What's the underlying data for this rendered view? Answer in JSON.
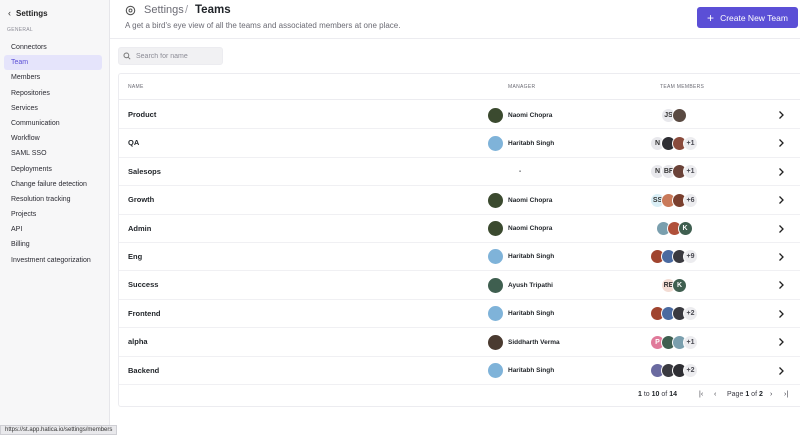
{
  "sidebar": {
    "title": "Settings",
    "section": "GENERAL",
    "items": [
      {
        "label": "Connectors",
        "active": false
      },
      {
        "label": "Team",
        "active": true
      },
      {
        "label": "Members",
        "active": false
      },
      {
        "label": "Repositories",
        "active": false
      },
      {
        "label": "Services",
        "active": false
      },
      {
        "label": "Communication",
        "active": false
      },
      {
        "label": "Workflow",
        "active": false
      },
      {
        "label": "SAML SSO",
        "active": false
      },
      {
        "label": "Deployments",
        "active": false
      },
      {
        "label": "Change failure detection",
        "active": false
      },
      {
        "label": "Resolution tracking",
        "active": false
      },
      {
        "label": "Projects",
        "active": false
      },
      {
        "label": "API",
        "active": false
      },
      {
        "label": "Billing",
        "active": false
      },
      {
        "label": "Investment categorization",
        "active": false
      }
    ]
  },
  "header": {
    "breadcrumb_root": "Settings",
    "breadcrumb_sep": "/",
    "breadcrumb_current": "Teams",
    "subtitle": "A get a bird's eye view of all the teams and associated members at one place.",
    "create_button": "Create New Team"
  },
  "search": {
    "placeholder": "Search for name"
  },
  "table": {
    "columns": {
      "name": "NAME",
      "manager": "MANAGER",
      "members": "TEAM MEMBERS"
    },
    "rows": [
      {
        "name": "Product",
        "manager": "Naomi Chopra",
        "manager_avatar": "#3b4a2f",
        "members": [
          {
            "t": "JS",
            "c": "#e8e8ec"
          },
          {
            "t": "",
            "c": "#5a4a42"
          }
        ],
        "more": ""
      },
      {
        "name": "QA",
        "manager": "Haritabh Singh",
        "manager_avatar": "#7fb3d9",
        "members": [
          {
            "t": "N",
            "c": "#e8e8ec"
          },
          {
            "t": "",
            "c": "#2e2e33"
          },
          {
            "t": "",
            "c": "#8a4b3c"
          }
        ],
        "more": "+1"
      },
      {
        "name": "Salesops",
        "manager": "-",
        "manager_avatar": "",
        "members": [
          {
            "t": "N",
            "c": "#e8e8ec"
          },
          {
            "t": "BF",
            "c": "#e8e8ec"
          },
          {
            "t": "",
            "c": "#6a4238"
          }
        ],
        "more": "+1"
      },
      {
        "name": "Growth",
        "manager": "Naomi Chopra",
        "manager_avatar": "#3b4a2f",
        "members": [
          {
            "t": "SS",
            "c": "#d9eef5"
          },
          {
            "t": "",
            "c": "#c97a5a"
          },
          {
            "t": "",
            "c": "#7a3f2e"
          }
        ],
        "more": "+6"
      },
      {
        "name": "Admin",
        "manager": "Naomi Chopra",
        "manager_avatar": "#3b4a2f",
        "members": [
          {
            "t": "",
            "c": "#7a9fae"
          },
          {
            "t": "",
            "c": "#b0503a"
          },
          {
            "t": "K",
            "c": "#3f5f50"
          }
        ],
        "more": ""
      },
      {
        "name": "Eng",
        "manager": "Haritabh Singh",
        "manager_avatar": "#7fb3d9",
        "members": [
          {
            "t": "",
            "c": "#a0442f"
          },
          {
            "t": "",
            "c": "#4a6aa0"
          },
          {
            "t": "",
            "c": "#3a3a40"
          }
        ],
        "more": "+9"
      },
      {
        "name": "Success",
        "manager": "Ayush Tripathi",
        "manager_avatar": "#3f5f50",
        "members": [
          {
            "t": "RE",
            "c": "#f3dcd4"
          },
          {
            "t": "K",
            "c": "#3f5f50"
          }
        ],
        "more": ""
      },
      {
        "name": "Frontend",
        "manager": "Haritabh Singh",
        "manager_avatar": "#7fb3d9",
        "members": [
          {
            "t": "",
            "c": "#a0442f"
          },
          {
            "t": "",
            "c": "#4a6aa0"
          },
          {
            "t": "",
            "c": "#3a3a40"
          }
        ],
        "more": "+2"
      },
      {
        "name": "alpha",
        "manager": "Siddharth Verma",
        "manager_avatar": "#4a3a30",
        "members": [
          {
            "t": "P",
            "c": "#e07a9a"
          },
          {
            "t": "",
            "c": "#3f5f50"
          },
          {
            "t": "",
            "c": "#7a9fae"
          }
        ],
        "more": "+1"
      },
      {
        "name": "Backend",
        "manager": "Haritabh Singh",
        "manager_avatar": "#7fb3d9",
        "members": [
          {
            "t": "",
            "c": "#6a6aa0"
          },
          {
            "t": "",
            "c": "#3a3a40"
          },
          {
            "t": "",
            "c": "#2e2e33"
          }
        ],
        "more": "+2"
      }
    ]
  },
  "pagination": {
    "range_start": "1",
    "range_to": "to",
    "range_end": "10",
    "range_of": "of",
    "total": "14",
    "page_word": "Page",
    "page": "1",
    "page_of": "of",
    "pages": "2"
  },
  "status_url": "https://st.app.hatica.io/settings/members"
}
